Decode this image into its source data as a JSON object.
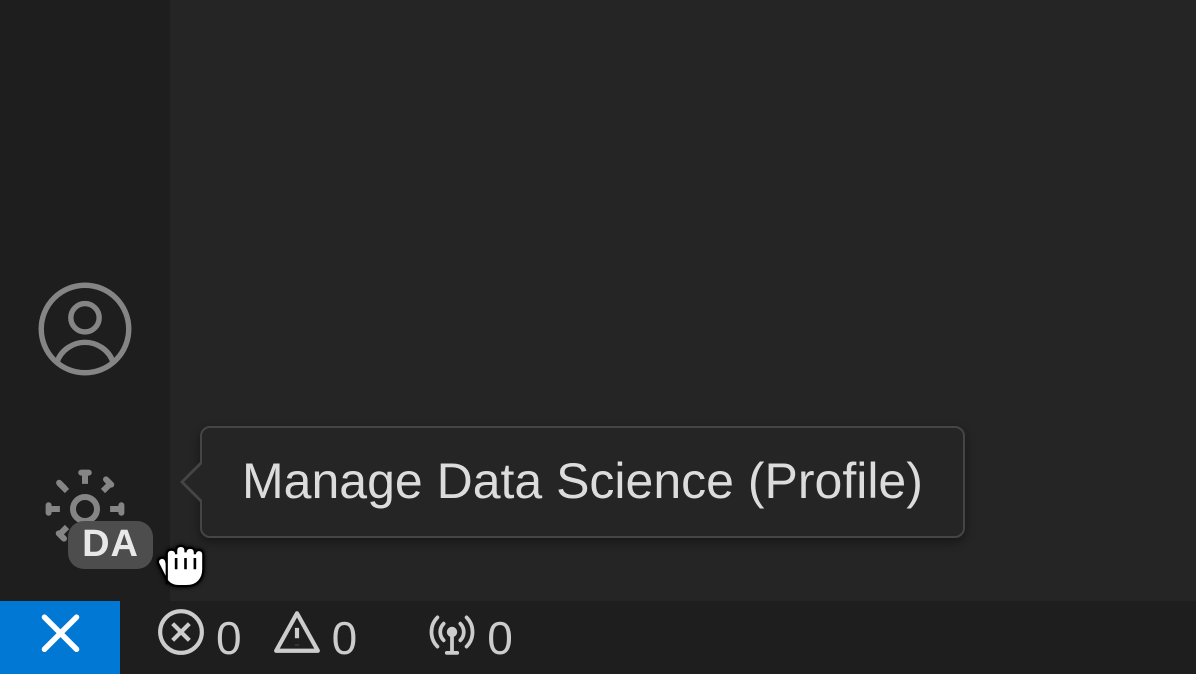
{
  "activityBar": {
    "gearBadge": "DA"
  },
  "tooltip": {
    "text": "Manage Data Science (Profile)"
  },
  "statusBar": {
    "errors": "0",
    "warnings": "0",
    "ports": "0"
  }
}
